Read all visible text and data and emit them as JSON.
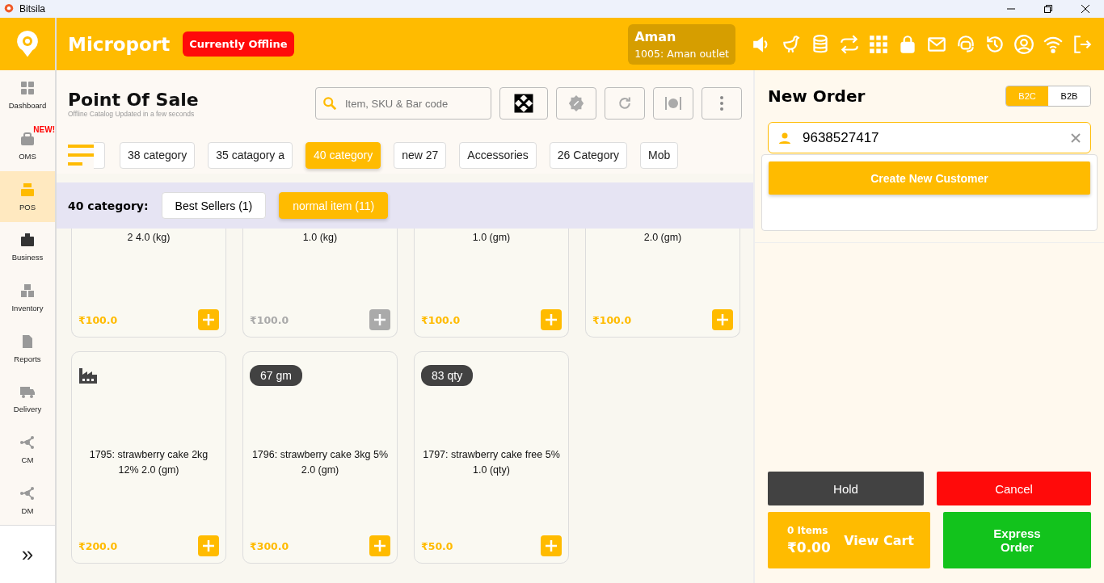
{
  "window": {
    "title": "Bitsila"
  },
  "header": {
    "brand": "Microport",
    "status_badge": "Currently Offline",
    "user": {
      "name": "Aman",
      "outlet": "1005: Aman outlet"
    }
  },
  "sidebar": {
    "items": [
      {
        "label": "Dashboard",
        "selected": false
      },
      {
        "label": "OMS",
        "selected": false,
        "badge": "NEW!"
      },
      {
        "label": "POS",
        "selected": true
      },
      {
        "label": "Business",
        "selected": false
      },
      {
        "label": "Inventory",
        "selected": false
      },
      {
        "label": "Reports",
        "selected": false
      },
      {
        "label": "Delivery",
        "selected": false
      },
      {
        "label": "CM",
        "selected": false
      },
      {
        "label": "DM",
        "selected": false
      }
    ],
    "expand": "»"
  },
  "pos": {
    "title": "Point Of Sale",
    "subtitle": "Offline Catalog Updated in a few seconds",
    "search": {
      "placeholder": "Item, SKU & Bar code"
    }
  },
  "categories": [
    {
      "label": "38 category",
      "selected": false
    },
    {
      "label": "35 catagory a",
      "selected": false
    },
    {
      "label": "40 category",
      "selected": true
    },
    {
      "label": "new 27",
      "selected": false
    },
    {
      "label": "Accessories",
      "selected": false
    },
    {
      "label": "26 Category",
      "selected": false
    },
    {
      "label": "Mob",
      "selected": false
    }
  ],
  "subcategories": {
    "label": "40 category:",
    "items": [
      {
        "label": "Best Sellers (1)",
        "selected": false
      },
      {
        "label": "normal item (11)",
        "selected": true
      }
    ]
  },
  "products": [
    {
      "kind": "partial",
      "name": "2 4.0 (kg)",
      "price": "₹100.0",
      "available": true
    },
    {
      "kind": "partial",
      "name": "1.0 (kg)",
      "price": "₹100.0",
      "available": false
    },
    {
      "kind": "partial",
      "name": "1.0 (gm)",
      "price": "₹100.0",
      "available": true
    },
    {
      "kind": "partial",
      "name": "2.0 (gm)",
      "price": "₹100.0",
      "available": true
    },
    {
      "kind": "factory",
      "name": "1795: strawberry cake 2kg 12% 2.0 (gm)",
      "price": "₹200.0",
      "available": true
    },
    {
      "kind": "tag",
      "tag": "67 gm",
      "name": "1796: strawberry cake 3kg 5% 2.0 (gm)",
      "price": "₹300.0",
      "available": true
    },
    {
      "kind": "tag",
      "tag": "83 qty",
      "name": "1797: strawberry cake free 5% 1.0 (qty)",
      "price": "₹50.0",
      "available": true
    }
  ],
  "order": {
    "title": "New Order",
    "modes": [
      {
        "label": "B2C",
        "selected": true
      },
      {
        "label": "B2B",
        "selected": false
      }
    ],
    "customer": {
      "value": "9638527417"
    },
    "create_button": "Create New Customer",
    "hold": "Hold",
    "cancel": "Cancel",
    "cart": {
      "items": "0 Items",
      "total": "₹0.00",
      "action": "View Cart"
    },
    "express": "Express Order"
  }
}
